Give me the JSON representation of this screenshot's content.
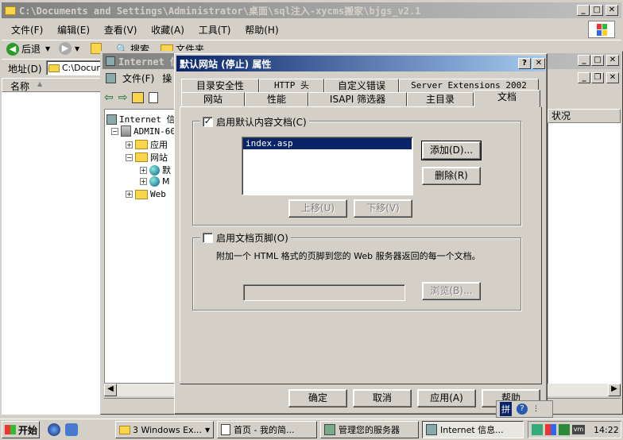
{
  "explorer": {
    "title": "C:\\Documents and Settings\\Administrator\\桌面\\sql注入-xycms搬家\\bjgs_v2.1",
    "menu": [
      "文件(F)",
      "编辑(E)",
      "查看(V)",
      "收藏(A)",
      "工具(T)",
      "帮助(H)"
    ],
    "back_label": "后退",
    "search_label": "搜索",
    "folders_label": "文件夹",
    "address_label": "地址(D)",
    "address_value": "C:\\Docum",
    "col_name": "名称"
  },
  "iis": {
    "title": "Internet 信",
    "menu": [
      "文件(F)",
      "操"
    ],
    "col_status": "状况",
    "tree": [
      {
        "label": "Internet 信",
        "icon": "iis-icon"
      },
      {
        "label": "ADMIN-60",
        "icon": "server-icon"
      },
      {
        "label": "应用",
        "icon": "folder-icon"
      },
      {
        "label": "网站",
        "icon": "folder-icon"
      },
      {
        "label": "默",
        "icon": "globe-icon"
      },
      {
        "label": "M",
        "icon": "globe-icon"
      },
      {
        "label": "Web",
        "icon": "folder-icon"
      }
    ]
  },
  "dialog": {
    "title": "默认网站 (停止) 属性",
    "help_btn": "?",
    "close_btn": "✕",
    "tabs_back": [
      "目录安全性",
      "HTTP 头",
      "自定义错误",
      "Server Extensions 2002"
    ],
    "tabs_front": [
      "网站",
      "性能",
      "ISAPI 筛选器",
      "主目录",
      "文档"
    ],
    "enable_default_label": "启用默认内容文档(C)",
    "default_docs": [
      "index.asp"
    ],
    "add_btn": "添加(D)...",
    "remove_btn": "删除(R)",
    "move_up_btn": "上移(U)",
    "move_down_btn": "下移(V)",
    "enable_footer_label": "启用文档页脚(O)",
    "footer_desc": "附加一个 HTML 格式的页脚到您的 Web 服务器返回的每一个文档。",
    "footer_path": "",
    "browse_btn": "浏览(B)...",
    "ok_btn": "确定",
    "cancel_btn": "取消",
    "apply_btn": "应用(A)",
    "help_bottom_btn": "帮助"
  },
  "taskbar": {
    "start_label": "开始",
    "tasks": [
      "3 Windows Ex...",
      "首页 - 我的简...",
      "管理您的服务器",
      "Internet 信息..."
    ],
    "clock": "14:22",
    "ime_label": "拼"
  },
  "colors": {
    "titlebar_active": "#0a246a",
    "titlebar_inactive": "#808080",
    "face": "#d4d0c8"
  }
}
